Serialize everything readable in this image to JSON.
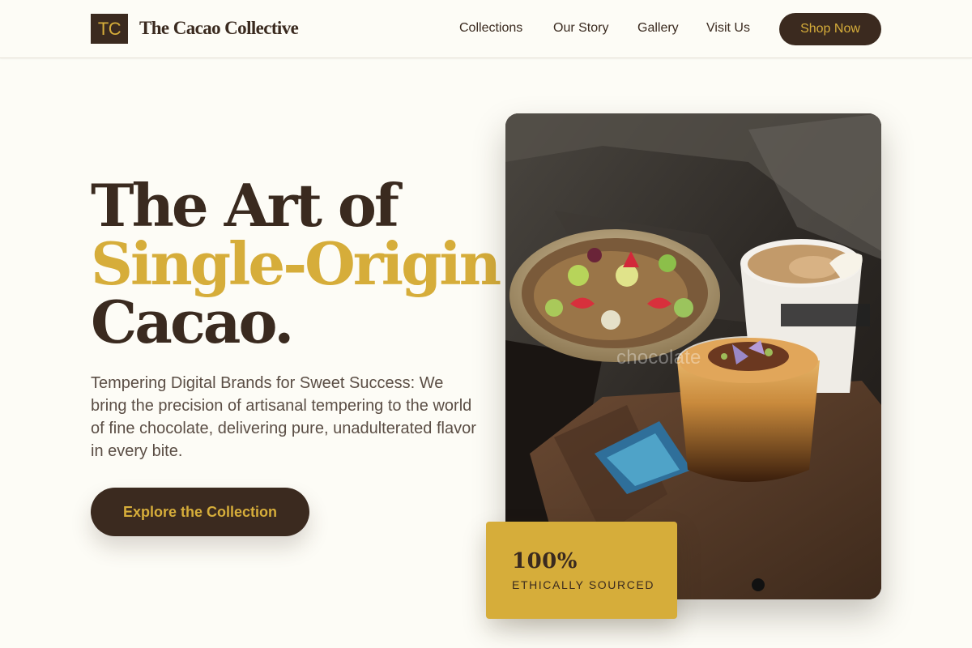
{
  "header": {
    "logo_text": "TC",
    "brand_name": "The Cacao Collective",
    "nav": [
      "Collections",
      "Our Story",
      "Gallery",
      "Visit Us"
    ],
    "shop_label": "Shop Now"
  },
  "hero": {
    "title_lines": [
      "The Art of",
      "Single-Origin",
      "Cacao."
    ],
    "description": "Tempering Digital Brands for Sweet Success: We bring the precision of artisanal tempering to the world of fine chocolate, delivering pure, unadulterated flavor in every bite.",
    "cta_label": "Explore the Collection",
    "image_watermark": "chocolate"
  },
  "badge": {
    "value": "100%",
    "label": "ETHICALLY SOURCED"
  },
  "colors": {
    "background": "#fdfcf6",
    "brown": "#3b2a1f",
    "gold": "#d6ad3a",
    "body_text": "#5b4e45"
  }
}
